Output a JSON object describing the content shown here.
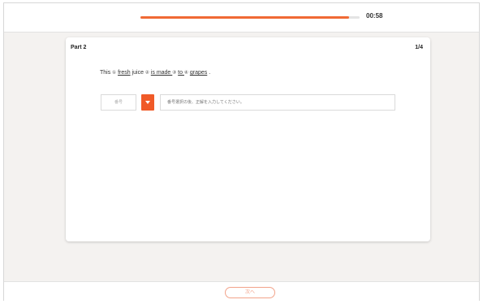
{
  "header": {
    "progress_fraction": 0.95,
    "timer": "00:58",
    "accent_color": "#f06a35"
  },
  "card": {
    "part_title": "Part 2",
    "page_count": "1/4",
    "question": {
      "w0": "This ",
      "n1": "①",
      "w1": "fresh",
      "w1b": " juice ",
      "n2": "②",
      "w2": "is made ",
      "n3": "③",
      "w3": "to ",
      "n4": "④",
      "w4": "grapes",
      "end": "."
    },
    "answer": {
      "select_value": "番号",
      "dropdown_icon": "chevron-down-icon",
      "input_placeholder": "番号選択の後、正解を入力してください。"
    }
  },
  "footer": {
    "next_label": "次へ"
  }
}
